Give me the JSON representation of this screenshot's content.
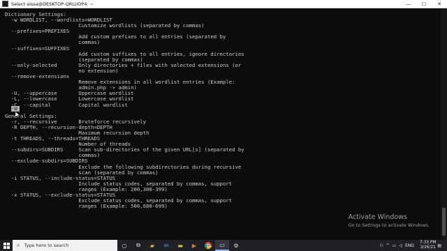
{
  "window": {
    "title": "Select aissa@DESKTOP-QRLUOP4: ~",
    "controls": {
      "minimize": "—",
      "maximize": "☐",
      "close": "✕"
    }
  },
  "console": {
    "lines": [
      "Dictionary Settings:",
      "  -w WORDLIST, --wordlists=WORDLIST",
      "                        Customize wordlists (separated by commas)",
      "  --prefixes=PREFIXES",
      "                        Add custom prefixes to all entries (separated by",
      "                        commas)",
      "  --suffixes=SUFFIXES",
      "                        Add custom suffixes to all entries, ignore directories",
      "                        (separated by commas)",
      "  --only-selected       Only directories + files with selected extensions (or",
      "                        no extension)",
      "  --remove-extensions",
      "                        Remove extensions in all wordlist entries (Example:",
      "                        admin.php -> admin)",
      "  -U, --uppercase       Uppercase wordlist",
      "  -L, --lowercase       Lowercase wordlist",
      "  -C, --capital         Capital wordlist",
      "",
      "General Settings:",
      "  -r, --recursive       Bruteforce recursively",
      "  -R DEPTH, --recursion-depth=DEPTH",
      "                        Maximum recursion depth",
      "  -t THREADS, --threads=THREADS",
      "                        Number of threads",
      "  --subdirs=SUBDIRS     Scan sub-directories of the given URL[s] (separated by",
      "                        commas)",
      "  --exclude-subdirs=SUBDIRS",
      "                        Exclude the following subdirectories during recursive",
      "                        scan (separated by commas)",
      "  -i STATUS, --include-status=STATUS",
      "                        Include status codes, separated by commas, support",
      "                        ranges (Example: 200,300-399)",
      "  -x STATUS, --exclude-status=STATUS",
      "                        Exclude status codes, separated by commas, support",
      "                        ranges (Example: 500,600-699)"
    ],
    "selection": "-U"
  },
  "watermark": {
    "title": "Activate Windows",
    "subtitle": "Go to Settings to activate Windows."
  },
  "taskbar": {
    "search_placeholder": "Type here to search",
    "icons": [
      "windows-icon",
      "search-icon",
      "cortana-icon",
      "task-view-icon",
      "folder-icon",
      "mail-icon",
      "explorer-icon",
      "media-icon",
      "chrome-icon",
      "terminal-icon",
      "settings-icon"
    ],
    "tray": {
      "language": "ENG",
      "time": "7:33 PM",
      "date": "3/26/21"
    }
  },
  "colors": {
    "console_bg": "#0c0c0c",
    "console_fg": "#cccccc",
    "taskbar_bg": "#1f1f26"
  }
}
